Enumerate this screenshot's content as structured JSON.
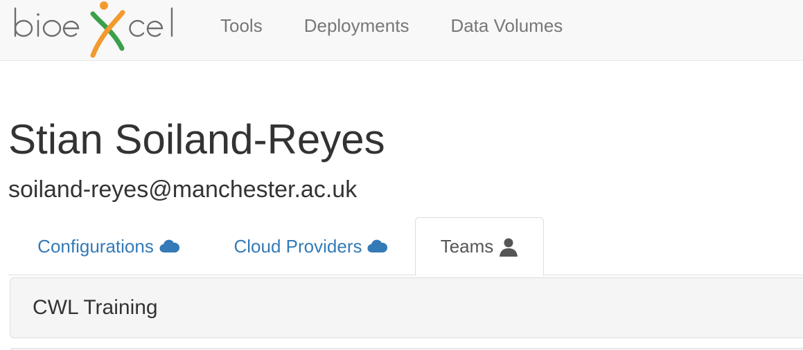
{
  "brand": {
    "logo_text": "bioexcel",
    "color_green": "#3aa14a",
    "color_orange": "#f39a2e",
    "color_gray": "#6d6d6d"
  },
  "nav": {
    "items": [
      {
        "label": "Tools"
      },
      {
        "label": "Deployments"
      },
      {
        "label": "Data Volumes"
      }
    ]
  },
  "user": {
    "name": "Stian Soiland-Reyes",
    "email": "soiland-reyes@manchester.ac.uk"
  },
  "tabs": {
    "items": [
      {
        "label": "Configurations",
        "icon": "cloud-icon"
      },
      {
        "label": "Cloud Providers",
        "icon": "cloud-icon"
      },
      {
        "label": "Teams",
        "icon": "user-icon",
        "active": true
      }
    ]
  },
  "teams": {
    "items": [
      {
        "name": "CWL Training"
      }
    ]
  },
  "colors": {
    "link": "#337ab7",
    "nav_text": "#777777",
    "active_tab_text": "#555555",
    "panel_bg": "#f5f5f5"
  }
}
